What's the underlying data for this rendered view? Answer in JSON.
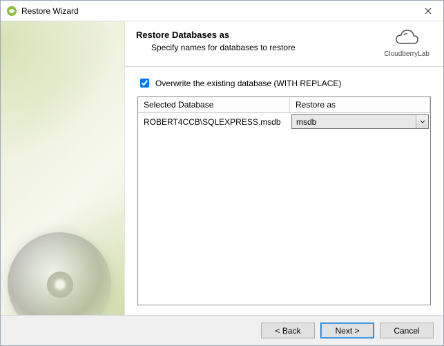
{
  "window": {
    "title": "Restore Wizard"
  },
  "header": {
    "title": "Restore Databases as",
    "subtitle": "Specify names for databases to restore",
    "brand": "CloudberryLab"
  },
  "options": {
    "overwrite_label": "Overwrite the existing database (WITH REPLACE)",
    "overwrite_checked": true
  },
  "grid": {
    "columns": {
      "selected": "Selected Database",
      "restore_as": "Restore as"
    },
    "rows": [
      {
        "selected": "ROBERT4CCB\\SQLEXPRESS.msdb",
        "restore_as": "msdb"
      }
    ]
  },
  "buttons": {
    "back": "< Back",
    "next": "Next >",
    "cancel": "Cancel"
  }
}
